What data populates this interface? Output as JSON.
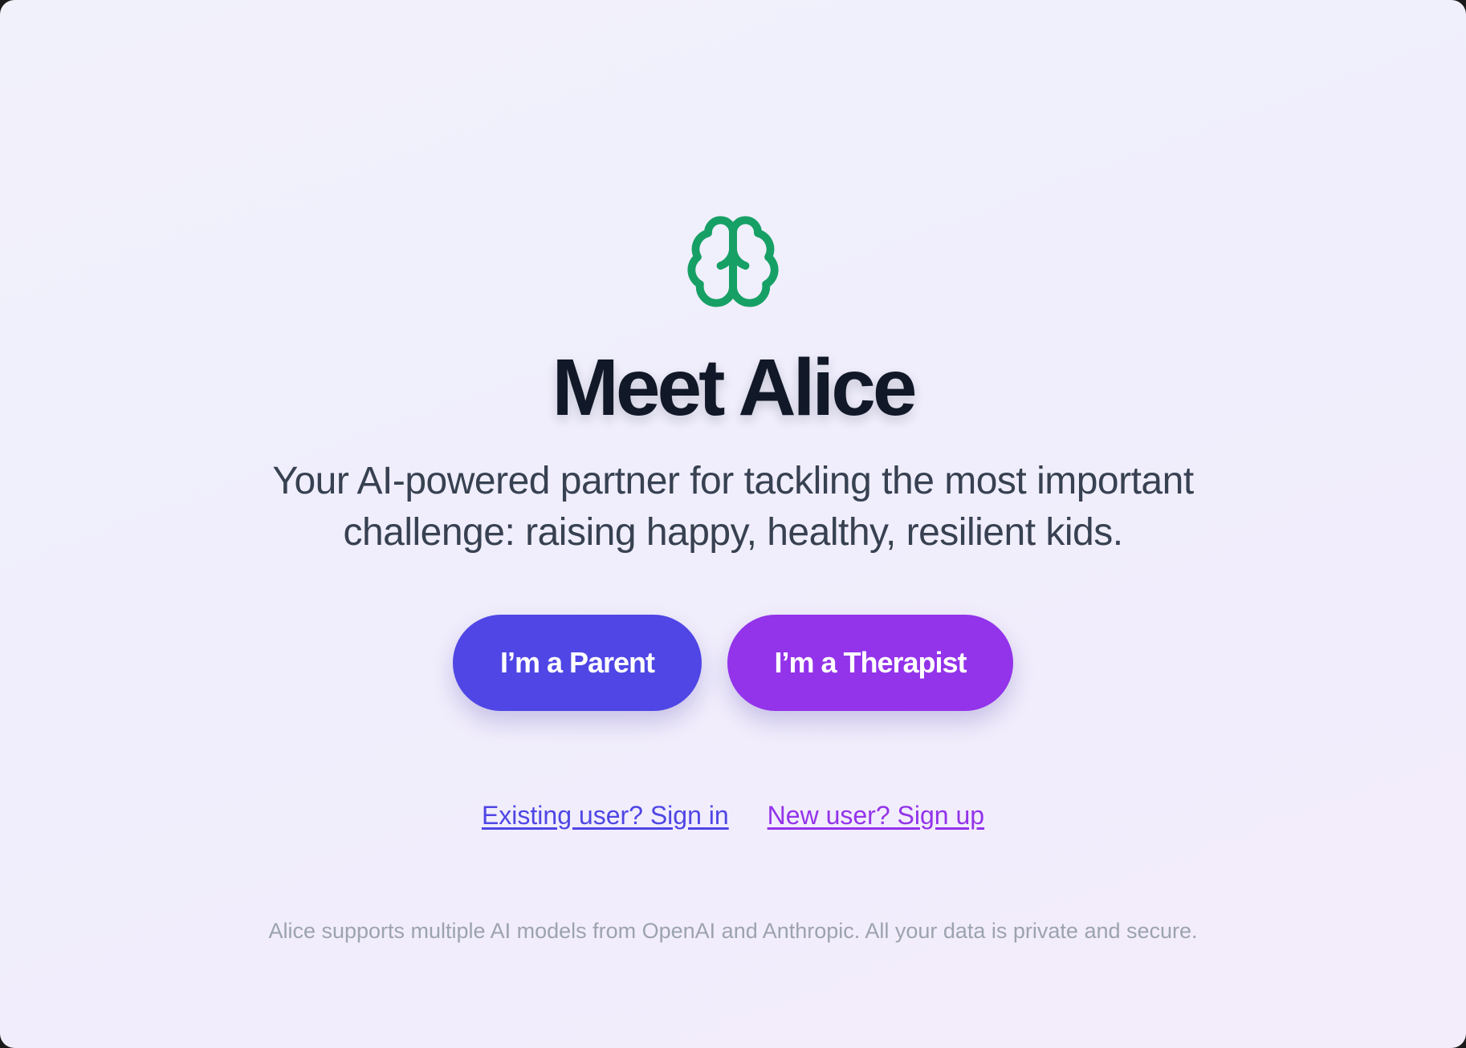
{
  "hero": {
    "logo_icon": "brain-icon",
    "title": "Meet Alice",
    "subtitle": "Your AI-powered partner for tackling the most important challenge: raising happy, healthy, resilient kids."
  },
  "actions": {
    "parent_label": "I’m a Parent",
    "therapist_label": "I’m a Therapist"
  },
  "auth_links": {
    "sign_in": "Existing user? Sign in",
    "sign_up": "New user? Sign up"
  },
  "footer": {
    "note": "Alice supports multiple AI models from OpenAI and Anthropic. All your data is private and secure."
  },
  "colors": {
    "brand_green": "#16a065",
    "parent_button": "#4f46e5",
    "therapist_button": "#9333ea",
    "title_text": "#111827",
    "background_start": "#f1f1fb",
    "background_end": "#f3ecfb"
  }
}
